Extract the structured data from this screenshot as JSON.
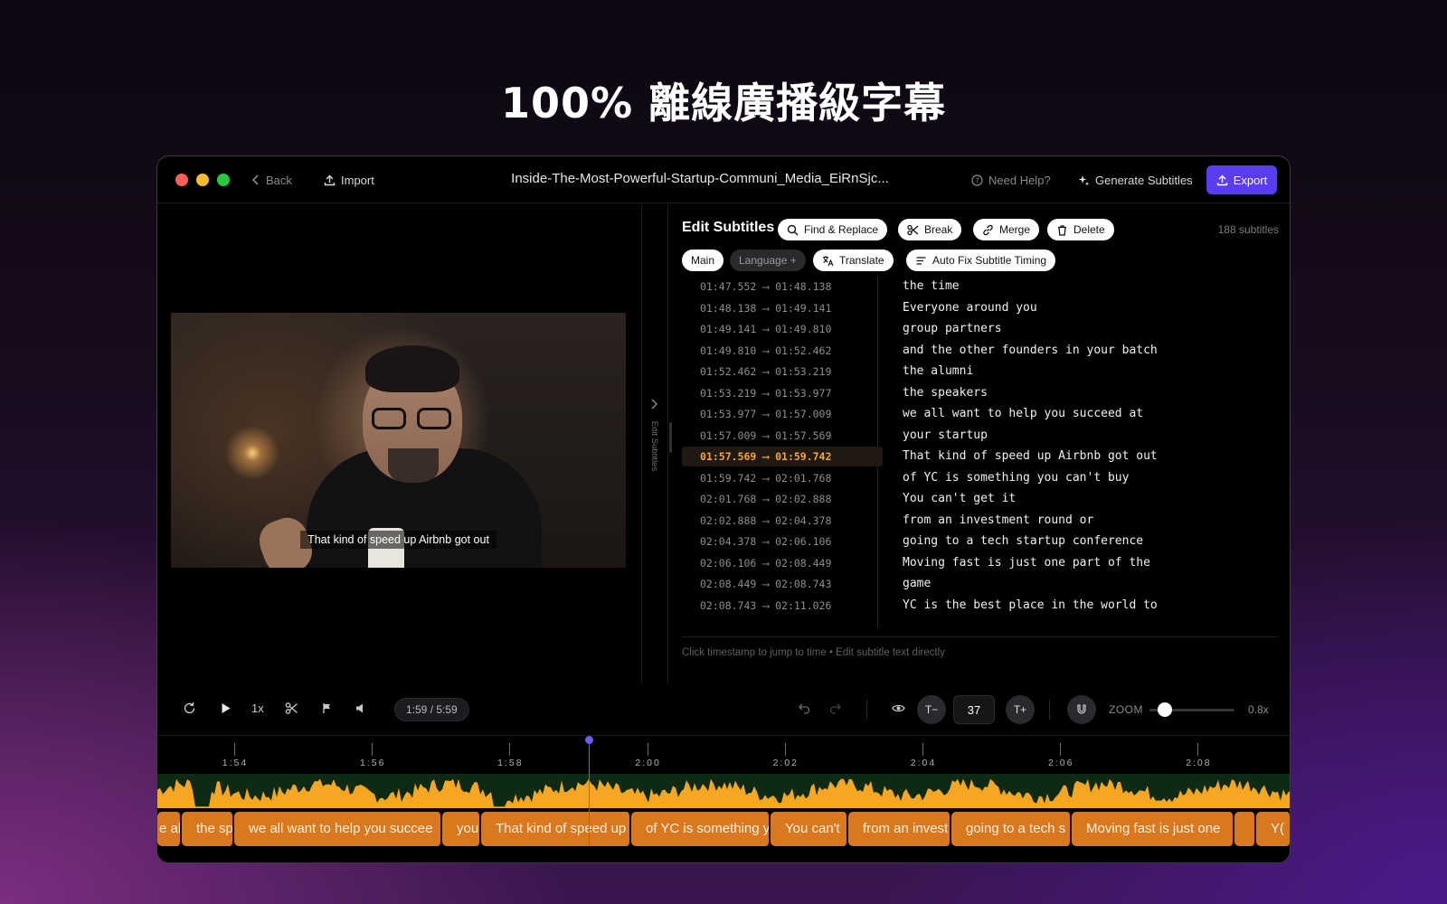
{
  "headline": "100% 離線廣播級字幕",
  "titlebar": {
    "back_label": "Back",
    "import_label": "Import",
    "filename": "Inside-The-Most-Powerful-Startup-Communi_Media_EiRnSjc...",
    "help_label": "Need Help?",
    "generate_label": "Generate Subtitles",
    "export_label": "Export"
  },
  "video": {
    "caption": "That kind of speed up Airbnb got out"
  },
  "rail": {
    "label": "Edit Subtitles"
  },
  "editor": {
    "title": "Edit Subtitles",
    "find_replace": "Find & Replace",
    "break": "Break",
    "merge": "Merge",
    "delete": "Delete",
    "count": "188 subtitles",
    "main_tab": "Main",
    "language_tab": "Language +",
    "translate": "Translate",
    "auto_fix": "Auto Fix Subtitle Timing",
    "hint": "Click timestamp to jump to time • Edit subtitle text directly",
    "subtitles": [
      {
        "start": "01:47.552",
        "end": "01:48.138",
        "text": "the time",
        "active": false
      },
      {
        "start": "01:48.138",
        "end": "01:49.141",
        "text": "Everyone around you",
        "active": false
      },
      {
        "start": "01:49.141",
        "end": "01:49.810",
        "text": "group partners",
        "active": false
      },
      {
        "start": "01:49.810",
        "end": "01:52.462",
        "text": "and the other founders in your batch",
        "active": false
      },
      {
        "start": "01:52.462",
        "end": "01:53.219",
        "text": "the alumni",
        "active": false
      },
      {
        "start": "01:53.219",
        "end": "01:53.977",
        "text": "the speakers",
        "active": false
      },
      {
        "start": "01:53.977",
        "end": "01:57.009",
        "text": "we all want to help you succeed at",
        "active": false
      },
      {
        "start": "01:57.009",
        "end": "01:57.569",
        "text": "your startup",
        "active": false
      },
      {
        "start": "01:57.569",
        "end": "01:59.742",
        "text": "That kind of speed up Airbnb got out",
        "active": true
      },
      {
        "start": "01:59.742",
        "end": "02:01.768",
        "text": "of YC is something you can't buy",
        "active": false
      },
      {
        "start": "02:01.768",
        "end": "02:02.888",
        "text": "You can't get it",
        "active": false
      },
      {
        "start": "02:02.888",
        "end": "02:04.378",
        "text": "from an investment round or",
        "active": false
      },
      {
        "start": "02:04.378",
        "end": "02:06.106",
        "text": "going to a tech startup conference",
        "active": false
      },
      {
        "start": "02:06.106",
        "end": "02:08.449",
        "text": "Moving fast is just one part of the",
        "active": false
      },
      {
        "start": "02:08.449",
        "end": "02:08.743",
        "text": "game",
        "active": false
      },
      {
        "start": "02:08.743",
        "end": "02:11.026",
        "text": "YC is the best place in the world to",
        "active": false
      }
    ]
  },
  "player": {
    "speed": "1x",
    "time": "1:59 / 5:59",
    "font_size": "37",
    "font_minus": "T−",
    "font_plus": "T+",
    "zoom_label": "ZOOM",
    "zoom_value": "0.8x",
    "zoom_level": 0.18
  },
  "timeline": {
    "ticks": [
      "1:54",
      "1:56",
      "1:58",
      "2:00",
      "2:02",
      "2:04",
      "2:06",
      "2:08"
    ],
    "clips": [
      "e all",
      "the sp",
      "we all want to help you succee",
      "you",
      "That kind of speed up",
      "of YC is something y",
      "You can't",
      "from an invest",
      "going to a tech s",
      "Moving fast is just one",
      "",
      "Y("
    ],
    "wave_color": "#f5a623",
    "clip_color": "#d9781f"
  },
  "colors": {
    "accent": "#5b3cf0",
    "active_time": "#f5a623"
  }
}
